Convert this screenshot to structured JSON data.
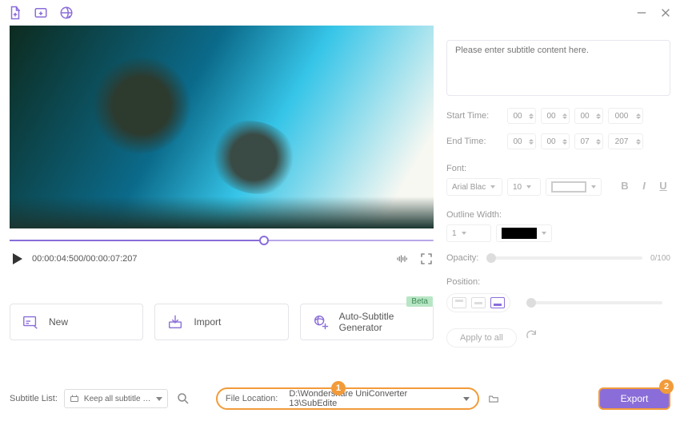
{
  "titlebar": {
    "icons": [
      "add-file-icon",
      "add-folder-icon",
      "add-url-icon"
    ]
  },
  "player": {
    "timecode": "00:00:04:500/00:00:07:207"
  },
  "actions": {
    "new": "New",
    "import": "Import",
    "auto": "Auto-Subtitle Generator",
    "beta": "Beta"
  },
  "editor": {
    "placeholder": "Please enter subtitle content here.",
    "start_label": "Start Time:",
    "end_label": "End Time:",
    "start": [
      "00",
      "00",
      "00",
      "000"
    ],
    "end": [
      "00",
      "00",
      "07",
      "207"
    ],
    "font_label": "Font:",
    "font_name": "Arial Blac",
    "font_size": "10",
    "outline_label": "Outline Width:",
    "outline_value": "1",
    "opacity_label": "Opacity:",
    "opacity_value": "0/100",
    "position_label": "Position:",
    "apply_all": "Apply to all"
  },
  "bottom": {
    "subtitle_list_label": "Subtitle List:",
    "subtitle_list_value": "Keep all subtitle tr...",
    "file_location_label": "File Location:",
    "file_location_value": "D:\\Wondershare UniConverter 13\\SubEdite",
    "export": "Export",
    "callout1": "1",
    "callout2": "2"
  }
}
